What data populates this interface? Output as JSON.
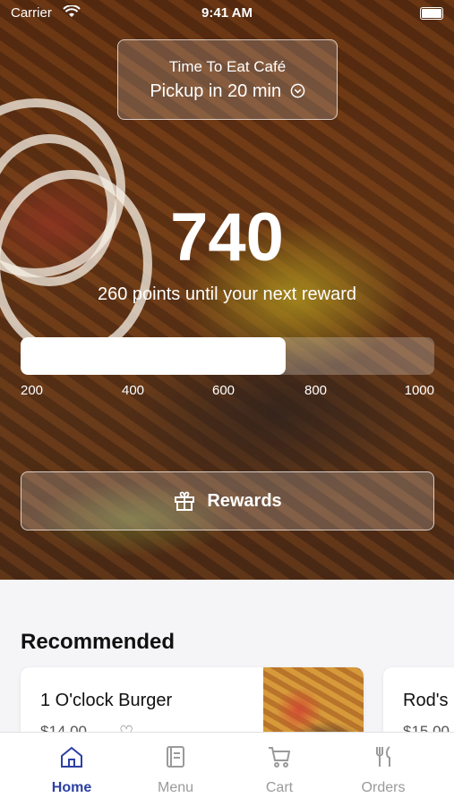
{
  "status_bar": {
    "carrier": "Carrier",
    "time": "9:41 AM"
  },
  "store": {
    "name": "Time To Eat Café",
    "pickup": "Pickup in 20 min"
  },
  "loyalty": {
    "points": "740",
    "message": "260 points until your next reward",
    "progress_fraction": 0.64,
    "ticks": [
      "200",
      "400",
      "600",
      "800",
      "1000"
    ],
    "button_label": "Rewards"
  },
  "recommended": {
    "title": "Recommended",
    "items": [
      {
        "name": "1 O'clock Burger",
        "price": "$14.00"
      },
      {
        "name": "Rod's",
        "price": "$15.00"
      }
    ]
  },
  "tabs": [
    {
      "label": "Home",
      "icon": "home-icon",
      "active": true
    },
    {
      "label": "Menu",
      "icon": "menu-book-icon",
      "active": false
    },
    {
      "label": "Cart",
      "icon": "cart-icon",
      "active": false
    },
    {
      "label": "Orders",
      "icon": "fork-knife-icon",
      "active": false
    }
  ],
  "colors": {
    "accent": "#2c40a3",
    "inactive": "#9a9a9a"
  }
}
